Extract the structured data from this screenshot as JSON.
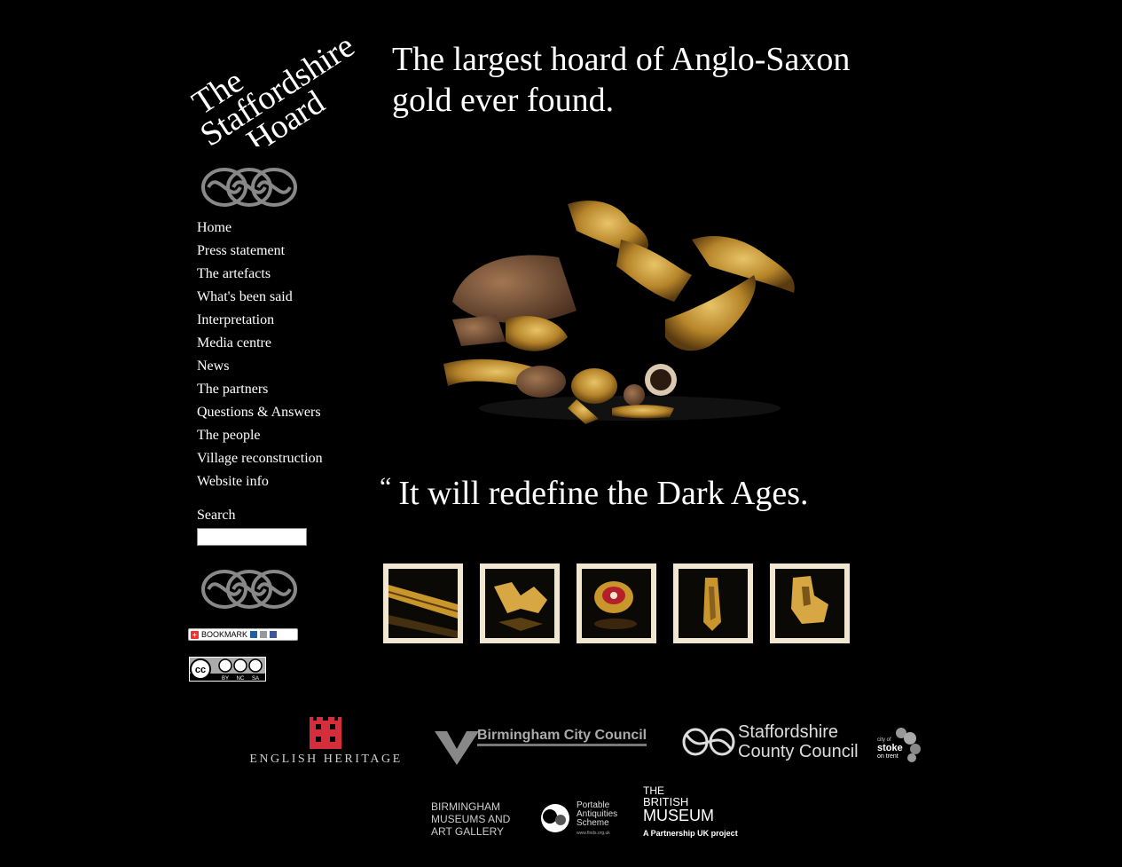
{
  "site": {
    "logo_lines": [
      "The",
      "Staffordshire",
      "Hoard"
    ],
    "headline_lines": [
      "The largest hoard of  Anglo-Saxon",
      "gold ever found."
    ]
  },
  "nav": {
    "items": [
      "Home",
      "Press statement",
      "The artefacts",
      "What's been said",
      "Interpretation",
      "Media centre",
      "News",
      "The partners",
      "Questions & Answers",
      "The people",
      "Village reconstruction",
      "Website info"
    ]
  },
  "search": {
    "label": "Search",
    "value": ""
  },
  "bookmark": {
    "label": "BOOKMARK"
  },
  "cc_license": {
    "labels": [
      "BY",
      "NC",
      "SA"
    ],
    "symbol": "cc"
  },
  "quote": {
    "mark": "“",
    "text": "It will redefine the Dark Ages."
  },
  "thumbnails": [
    {
      "name": "thumb-sword-fitting"
    },
    {
      "name": "thumb-gold-fragment"
    },
    {
      "name": "thumb-garnet-mount"
    },
    {
      "name": "thumb-hilt-fitting"
    },
    {
      "name": "thumb-gold-piece"
    }
  ],
  "partners": {
    "english_heritage": "ENGLISH HERITAGE",
    "birmingham_cc": "Birmingham City Council",
    "staffordshire_cc": [
      "Staffordshire",
      "County Council"
    ],
    "stoke": {
      "small": "city of",
      "big": "stoke",
      "sub": "on trent"
    },
    "bmag": [
      "BIRMINGHAM",
      "MUSEUMS AND",
      "ART GALLERY"
    ],
    "pas": {
      "lines": [
        "Portable",
        "Antiquities",
        "Scheme"
      ],
      "url": "www.finds.org.uk"
    },
    "british_museum": {
      "lines": [
        "THE",
        "BRITISH",
        "MUSEUM"
      ],
      "tagline": "A Partnership UK project"
    }
  },
  "colors": {
    "background": "#000000",
    "thumb_border": "#f1e6cf",
    "eh_red": "#d42d3b",
    "gold": "#c9962c"
  }
}
